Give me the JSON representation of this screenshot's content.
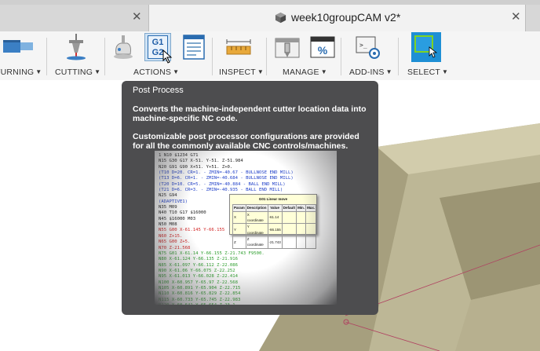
{
  "tabs": {
    "active_title": "week10groupCAM v2*",
    "close_glyph": "✕"
  },
  "toolbar": {
    "groups": [
      {
        "label": "TURNING"
      },
      {
        "label": "CUTTING"
      },
      {
        "label": "ACTIONS"
      },
      {
        "label": "INSPECT"
      },
      {
        "label": "MANAGE"
      },
      {
        "label": "ADD-INS"
      },
      {
        "label": "SELECT"
      }
    ],
    "caret": "▼",
    "g1g2_top": "G1",
    "g1g2_bottom": "G2",
    "percent_glyph": "%",
    "script_glyph": ">_"
  },
  "tooltip": {
    "title": "Post Process",
    "paragraph1": "Converts the machine-independent cutter location data into machine-specific NC code.",
    "paragraph2": "Customizable post processor configurations are provided for all the commonly available CNC controls/machines."
  },
  "preview": {
    "lines": [
      {
        "text": "1 N10 $1234 G71",
        "color": "#222222"
      },
      {
        "text": "N15 G30 G17 X-51. Y-51. Z-51.984",
        "color": "#222222"
      },
      {
        "text": "N20 G91 G90 X+51. Y+51. Z+0.",
        "color": "#222222"
      },
      {
        "text": "(T10  D=20. CR=1. - ZMIN=-40.67 - BULLNOSE END MILL)",
        "color": "#1f3fc8"
      },
      {
        "text": "(T13  D=6. CR=1. - ZMIN=-40.684 - BULLNOSE END MILL)",
        "color": "#1f3fc8"
      },
      {
        "text": "(T20  D=10. CR=5. - ZMIN=-40.884 - BALL END MILL)",
        "color": "#1f3fc8"
      },
      {
        "text": "(T21  D=6. CR=3. - ZMIN=-40.935 - BALL END MILL)",
        "color": "#1f3fc8"
      },
      {
        "text": "N25 G94",
        "color": "#222222"
      },
      {
        "text": "(ADAPTIVE1)",
        "color": "#1f3fc8"
      },
      {
        "text": "N35 M09",
        "color": "#222222"
      },
      {
        "text": "N40 T10 G17 $16000",
        "color": "#222222"
      },
      {
        "text": "N45 $16000 M03",
        "color": "#222222"
      },
      {
        "text": "N50 M08",
        "color": "#222222"
      },
      {
        "text": "N55 G00 X-61.145 Y-66.155",
        "color": "#d22222"
      },
      {
        "text": "N60 Z+15.",
        "color": "#d22222"
      },
      {
        "text": "N65 G00 Z+5.",
        "color": "#d22222"
      },
      {
        "text": "N70 Z-21.568",
        "color": "#d22222"
      },
      {
        "text": "N75 G01 X-61.14 Y-66.155 Z-21.743 F9500.",
        "color": "#2e9e2e"
      },
      {
        "text": "N80 X-61.124 Y-66.135 Z-21.916",
        "color": "#2e9e2e"
      },
      {
        "text": "N85 X-61.097 Y-66.112 Z-22.086",
        "color": "#2e9e2e"
      },
      {
        "text": "N90 X-61.06 Y-66.075 Z-22.252",
        "color": "#2e9e2e"
      },
      {
        "text": "N95 X-61.013 Y-66.028 Z-22.414",
        "color": "#2e9e2e"
      },
      {
        "text": "N100 X-60.957 Y-65.97 Z-22.568",
        "color": "#2e9e2e"
      },
      {
        "text": "N105 X-60.891 Y-65.904 Z-22.715",
        "color": "#2e9e2e"
      },
      {
        "text": "N110 X-60.816 Y-65.829 Z-22.854",
        "color": "#2e9e2e"
      },
      {
        "text": "N115 X-60.733 Y-65.745 Z-22.983",
        "color": "#2e9e2e"
      },
      {
        "text": "N120 X-60.641 Y-65.654 Z-23.1",
        "color": "#2e9e2e"
      }
    ],
    "dialog": {
      "title": "G01 Linear move",
      "headers": [
        "Param",
        "Description",
        "Value",
        "Default",
        "Min.",
        "Max."
      ],
      "rows": [
        [
          "X",
          "X coordinate",
          "-61.14",
          "",
          "",
          ""
        ],
        [
          "Y",
          "Y coordinate",
          "-66.155",
          "",
          "",
          ""
        ],
        [
          "Z",
          "Z coordinate",
          "-21.743",
          "",
          "",
          ""
        ]
      ]
    }
  },
  "colors": {
    "tooltip_bg": "#4d4d4f",
    "model_olive": "#a6a083",
    "model_olive_light": "#c8c2a2",
    "select_icon_bg": "#1e8fd5"
  }
}
